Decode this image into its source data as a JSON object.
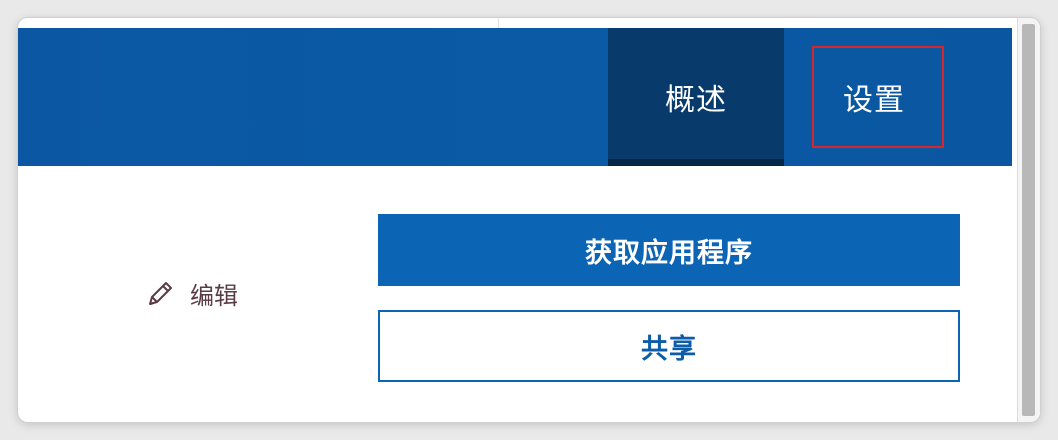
{
  "header": {
    "tabs": [
      {
        "label": "概述",
        "selected": true
      },
      {
        "label": "设置",
        "selected": false,
        "highlighted": true
      }
    ],
    "color": "#0a5aa6",
    "selected_tab_color": "#083a6c",
    "highlight_color": "#d9262b"
  },
  "main": {
    "edit": {
      "label": "编辑",
      "icon": "pencil-icon"
    },
    "get_app_button": {
      "label": "获取应用程序",
      "color": "#0c64b5"
    },
    "share_button": {
      "label": "共享"
    }
  }
}
